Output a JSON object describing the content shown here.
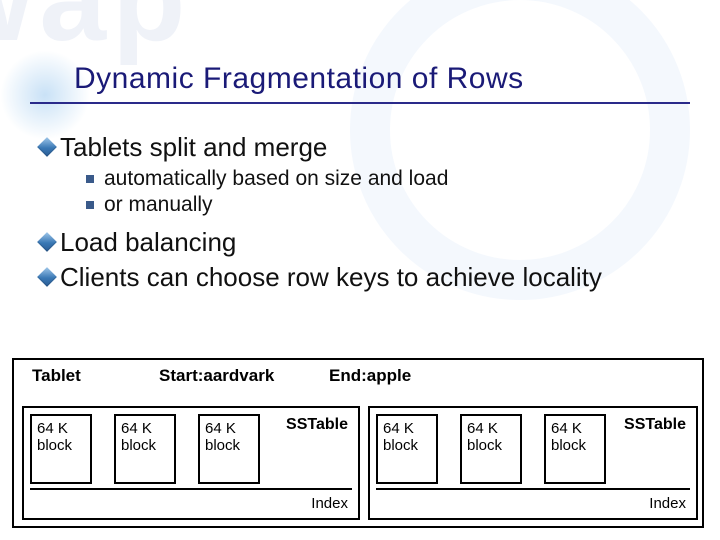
{
  "bg_text": "wap",
  "title": "Dynamic Fragmentation of Rows",
  "bullets": {
    "items": [
      {
        "text": "Tablets split and merge",
        "subs": [
          "automatically based on size and load",
          "or manually"
        ]
      },
      {
        "text": "Load balancing",
        "subs": []
      },
      {
        "text": "Clients can choose row keys to achieve locality",
        "subs": []
      }
    ]
  },
  "diagram": {
    "tablet_label": "Tablet",
    "start_label": "Start:aardvark",
    "end_label": "End:apple",
    "block_label": "64 K\nblock",
    "sstable_label": "SSTable",
    "index_label": "Index"
  }
}
